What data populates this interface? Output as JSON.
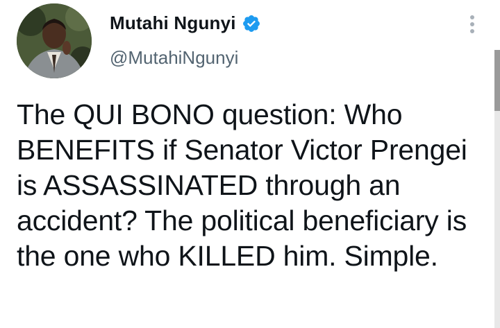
{
  "tweet": {
    "author": {
      "display_name": "Mutahi Ngunyi",
      "handle": "@MutahiNgunyi",
      "verified": true
    },
    "text": "The QUI BONO question: Who BENEFITS if Senator Victor Prengei is ASSASSINATED through an accident? The political beneficiary is the one who KILLED him. Simple."
  },
  "icons": {
    "verified": "verified-badge-icon",
    "more": "more-options-icon"
  },
  "colors": {
    "verified_badge": "#1d9bf0",
    "name_text": "#0f1419",
    "handle_text": "#536471"
  }
}
